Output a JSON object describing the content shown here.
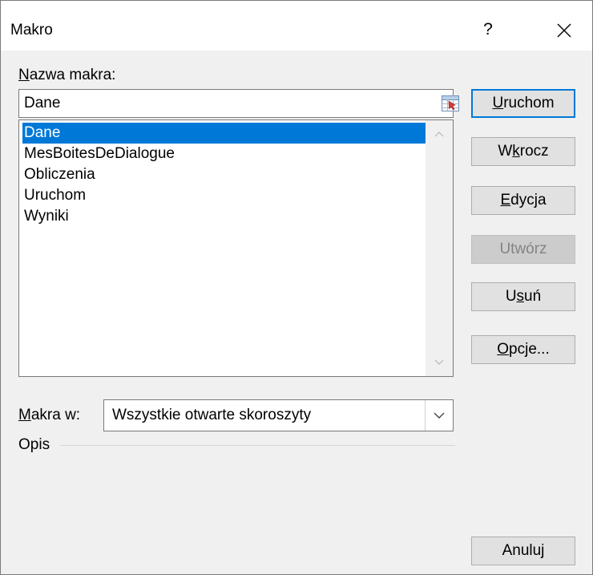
{
  "window": {
    "title": "Makro",
    "help_label": "?",
    "close_icon": "close-icon"
  },
  "macro_name": {
    "label_key": "N",
    "label_rest": "azwa makra:",
    "value": "Dane",
    "picker_icon": "range-picker-icon"
  },
  "macro_list": {
    "items": [
      "Dane",
      "MesBoitesDeDialogue",
      "Obliczenia",
      "Uruchom",
      "Wyniki"
    ],
    "selected_index": 0
  },
  "buttons": {
    "run": {
      "key": "U",
      "rest": "ruchom"
    },
    "step_into": {
      "pre": "W",
      "key": "k",
      "rest": "rocz"
    },
    "edit": {
      "key": "E",
      "rest": "dycja"
    },
    "create": {
      "label": "Utwórz"
    },
    "delete": {
      "pre": "U",
      "key": "s",
      "rest": "uń"
    },
    "options": {
      "key": "O",
      "rest": "pcje..."
    },
    "cancel": {
      "label": "Anuluj"
    }
  },
  "macros_in": {
    "label_key": "M",
    "label_rest": "akra w:",
    "value": "Wszystkie otwarte skoroszyty"
  },
  "description": {
    "label": "Opis"
  },
  "colors": {
    "accent": "#0078d7",
    "dialog_bg": "#f0f0f0"
  }
}
